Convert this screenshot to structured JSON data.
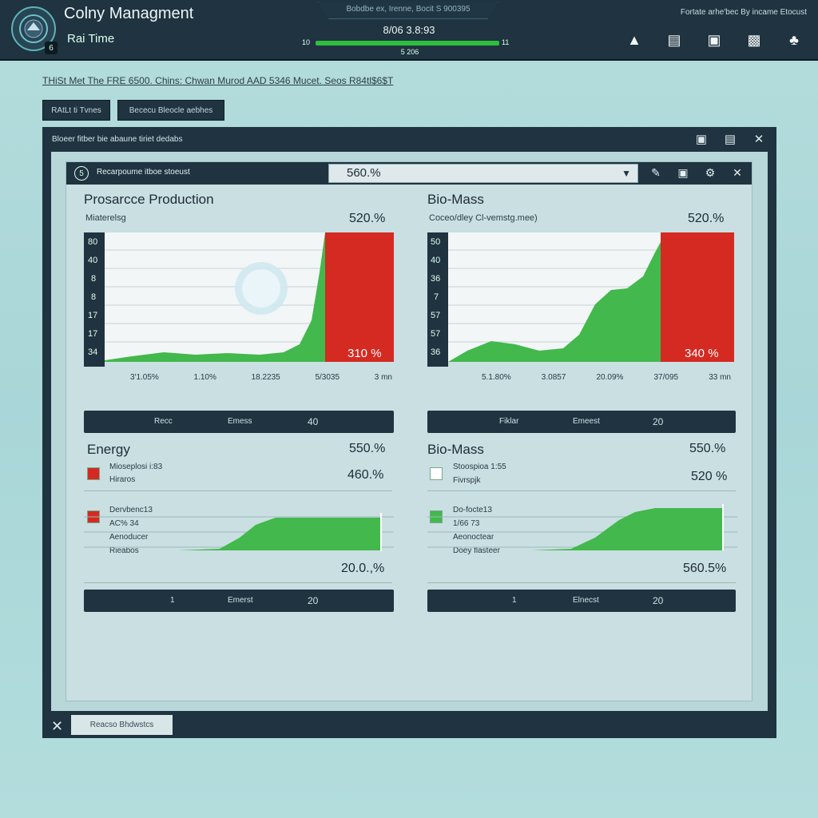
{
  "app": {
    "title": "Colny Managment",
    "subtitle": "Rai Time",
    "logo_badge": "6",
    "hud_label": "Bobdbe ex, Irenne, Bocit S 900395",
    "hud_value": "8/06 3.8:93",
    "hud_left": "10",
    "hud_right": "11",
    "hud_below": "5 206",
    "top_right_text": "Fortate arhe'bec By incame Etocust",
    "top_icons": [
      "warning-icon",
      "inventory-icon",
      "lock-icon",
      "toolbox-icon",
      "research-icon"
    ]
  },
  "breadcrumb": "THiSt  Met The FRE 6500. Chins: Chwan Murod AAD 5346 Mucet.   Seos R84tl$6$T",
  "tabs": [
    "RAtLt ti Tvnes",
    "Bececu Bleocle aebhes"
  ],
  "window": {
    "title": "Bloeer fitber bie abaune tiriet dedabs",
    "panel_title": "Recarpoume itboe stoeust",
    "panel_badge": "5",
    "select_value": "560.%",
    "bottom_button": "Reacso Bhdwstcs"
  },
  "cards": {
    "production": {
      "title": "Prosarcce Production",
      "sub": "Miaterelsg",
      "pct": "520.%",
      "yticks": [
        "80",
        "40",
        "8",
        "8",
        "17",
        "17",
        "34"
      ],
      "xticks": [
        "3'1.05%",
        "1.10%",
        "18.2235",
        "5/3035",
        "3 mn"
      ],
      "chart_label": "310 %",
      "bar": {
        "a": "Recc",
        "b": "Emess",
        "c": "40"
      }
    },
    "biomass_chart": {
      "title": "Bio-Mass",
      "sub": "Coceo/dley Cl-vemstg.mee)",
      "pct": "520.%",
      "yticks": [
        "50",
        "40",
        "36",
        "7",
        "57",
        "57",
        "36"
      ],
      "xticks": [
        "5.1.80%",
        "3.0857",
        "20.09%",
        "37/095",
        "33 mn"
      ],
      "chart_label": "340 %",
      "bar": {
        "a": "Fiklar",
        "b": "Emeest",
        "c": "20"
      }
    },
    "energy": {
      "title": "Energy",
      "pct_top": "550.%",
      "pct_mid": "460.%",
      "legend1": [
        "Mioseplosi i:83",
        "Hiraros"
      ],
      "legend2": [
        "Dervbenc13",
        "AC% 34",
        "Aenoducer",
        "Rieabos"
      ],
      "pct_bottom": "20.0.,%",
      "bar": {
        "a": "1",
        "b": "Emerst",
        "c": "20"
      },
      "colors": {
        "legend1": "#d42a22",
        "legend2": "#d42a22"
      }
    },
    "biomass_small": {
      "title": "Bio-Mass",
      "pct_top": "550.%",
      "pct_mid": "520 %",
      "legend1": [
        "Stoospioa 1:55",
        "Fivrspjk"
      ],
      "legend2": [
        "Do-focte13",
        "1/66 73",
        "Aeonoctear",
        "Doey flasteer"
      ],
      "pct_bottom": "560.5%",
      "bar": {
        "a": "1",
        "b": "Elnecst",
        "c": "20"
      },
      "colors": {
        "legend1": "#ffffff",
        "legend2": "#43b84c"
      }
    }
  },
  "colors": {
    "dark": "#1f3340",
    "green": "#43b84c",
    "red": "#d42a22"
  }
}
